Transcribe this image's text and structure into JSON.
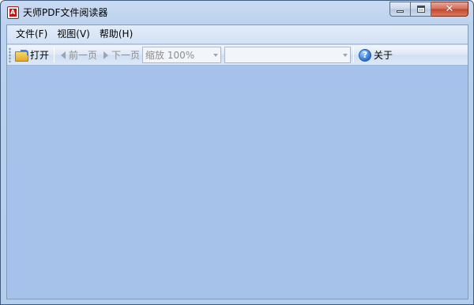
{
  "window": {
    "title": "天师PDF文件阅读器",
    "app_icon_letter": "A",
    "close_glyph": "✕"
  },
  "menu": [
    {
      "label": "文件(F)"
    },
    {
      "label": "视图(V)"
    },
    {
      "label": "帮助(H)"
    }
  ],
  "toolbar": {
    "open_label": "打开",
    "prev_page_label": "前一页",
    "next_page_label": "下一页",
    "zoom_value": "缩放 100%",
    "page_value": "",
    "about_label": "关于",
    "help_glyph": "?"
  },
  "colors": {
    "document_background": "#a6c2ea",
    "disabled_text": "#8d8d8d"
  }
}
